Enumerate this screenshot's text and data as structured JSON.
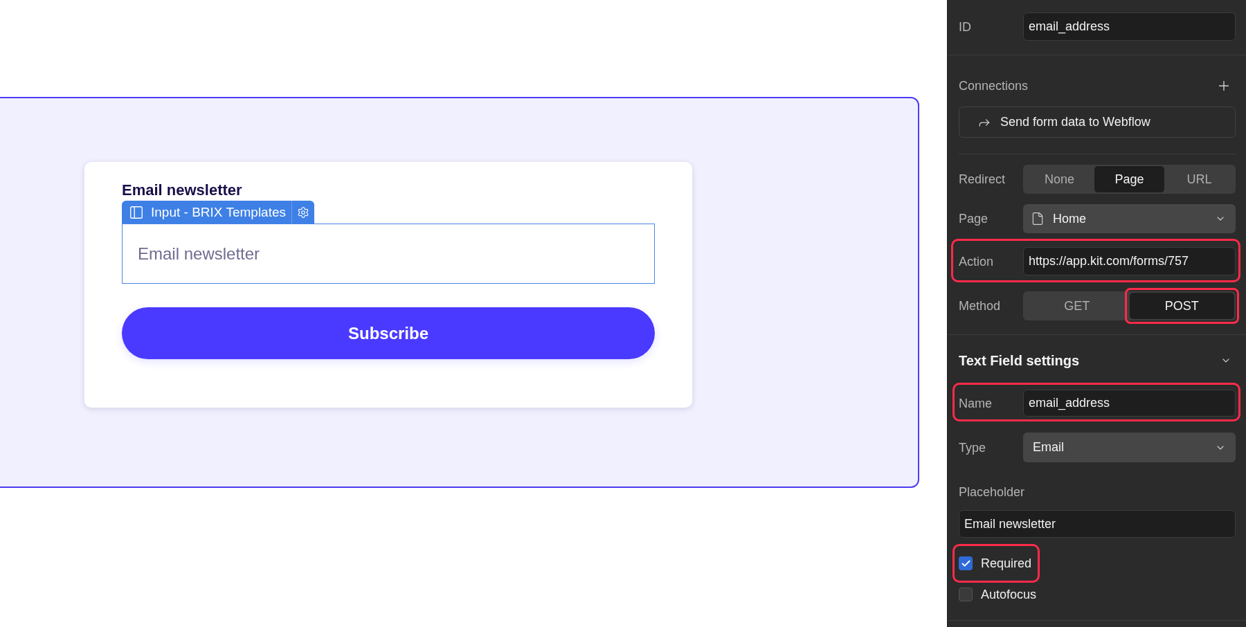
{
  "canvas": {
    "section": {
      "card": {
        "heading": "Email newsletter",
        "element_badge": {
          "label": "Input - BRIX Templates"
        },
        "email_input": {
          "placeholder": "Email newsletter",
          "selected": true
        },
        "submit_button": {
          "label": "Subscribe"
        }
      }
    }
  },
  "panel": {
    "id_field": {
      "label": "ID",
      "value": "email_address"
    },
    "connections": {
      "title": "Connections",
      "action_button": {
        "label": "Send form data to Webflow"
      }
    },
    "redirect": {
      "label": "Redirect",
      "options": [
        {
          "label": "None",
          "selected": false
        },
        {
          "label": "Page",
          "selected": true
        },
        {
          "label": "URL",
          "selected": false
        }
      ]
    },
    "page": {
      "label": "Page",
      "value": "Home"
    },
    "action": {
      "label": "Action",
      "value": "https://app.kit.com/forms/757",
      "highlighted": true
    },
    "method": {
      "label": "Method",
      "options": [
        {
          "label": "GET",
          "selected": false,
          "highlighted": false
        },
        {
          "label": "POST",
          "selected": true,
          "highlighted": true
        }
      ]
    },
    "text_field_settings": {
      "title": "Text Field settings",
      "name": {
        "label": "Name",
        "value": "email_address",
        "highlighted": true
      },
      "type": {
        "label": "Type",
        "value": "Email"
      },
      "placeholder": {
        "label": "Placeholder",
        "value": "Email newsletter"
      },
      "checkboxes": [
        {
          "label": "Required",
          "checked": true,
          "highlighted": true
        },
        {
          "label": "Autofocus",
          "checked": false,
          "highlighted": false
        }
      ]
    }
  }
}
